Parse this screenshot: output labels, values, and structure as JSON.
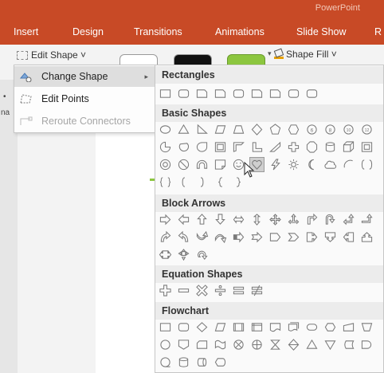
{
  "app": {
    "title_fragment": "PowerPoint"
  },
  "ribbon_tabs": [
    "Insert",
    "Design",
    "Transitions",
    "Animations",
    "Slide Show",
    "R"
  ],
  "toolbar": {
    "edit_shape_label": "Edit Shape ˅",
    "shape_fill_label": "Shape Fill ˅"
  },
  "slide_edge": {
    "text_a": "•",
    "text_b": "na"
  },
  "edit_shape_menu": {
    "items": [
      {
        "label": "Change Shape",
        "state": "highlighted",
        "has_submenu": true
      },
      {
        "label": "Edit Points",
        "state": "enabled"
      },
      {
        "label": "Reroute Connectors",
        "state": "disabled"
      }
    ]
  },
  "shape_gallery": {
    "categories": [
      {
        "name": "Rectangles",
        "count": 9
      },
      {
        "name": "Basic Shapes",
        "count": 42,
        "highlighted_index": 29
      },
      {
        "name": "Block Arrows",
        "count": 27
      },
      {
        "name": "Equation Shapes",
        "count": 6
      },
      {
        "name": "Flowchart",
        "count": 28
      }
    ]
  },
  "colors": {
    "ribbon_accent": "#c84a26",
    "shape_fill_bucket": "#e8a000",
    "gallery_swatch_2": "#111111",
    "gallery_swatch_3": "#8cc63f"
  }
}
